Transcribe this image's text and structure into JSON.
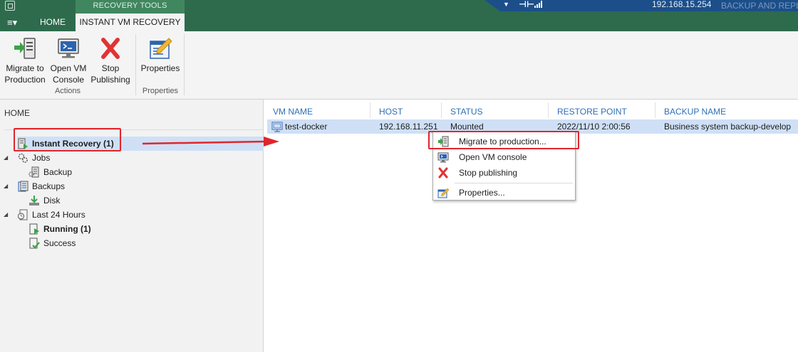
{
  "titlebar": {
    "context_label": "RECOVERY TOOLS",
    "menu_glyph": "≡▾",
    "tabs": [
      {
        "label": "HOME",
        "active": false
      },
      {
        "label": "INSTANT VM RECOVERY",
        "active": true
      }
    ],
    "server": "192.168.15.254",
    "product": "BACKUP AND REPLICATION"
  },
  "ribbon": {
    "groups": [
      {
        "label": "Actions",
        "buttons": [
          {
            "label": "Migrate to Production",
            "icon": "migrate-icon"
          },
          {
            "label": "Open VM Console",
            "icon": "vm-console-icon"
          },
          {
            "label": "Stop Publishing",
            "icon": "stop-red-x-icon"
          }
        ]
      },
      {
        "label": "Properties",
        "buttons": [
          {
            "label": "Properties",
            "icon": "properties-icon"
          }
        ]
      }
    ]
  },
  "tree": {
    "title": "HOME",
    "nodes": [
      {
        "label": "Instant Recovery (1)",
        "icon": "instant-recovery-icon",
        "selected": true,
        "bold": true
      },
      {
        "label": "Jobs",
        "icon": "jobs-gear-icon"
      },
      {
        "label": "Backup",
        "icon": "backup-job-icon"
      },
      {
        "label": "Backups",
        "icon": "backups-icon"
      },
      {
        "label": "Disk",
        "icon": "disk-icon"
      },
      {
        "label": "Last 24 Hours",
        "icon": "last-24-hours-icon"
      },
      {
        "label": "Running (1)",
        "icon": "running-icon",
        "bold": true
      },
      {
        "label": "Success",
        "icon": "success-icon"
      }
    ]
  },
  "list": {
    "columns": [
      "VM NAME",
      "HOST",
      "STATUS",
      "RESTORE POINT",
      "BACKUP NAME"
    ],
    "rows": [
      {
        "vm_name": "test-docker",
        "host": "192.168.11.251",
        "status": "Mounted",
        "restore_point": "2022/11/10 2:00:56",
        "backup_name": "Business system backup-develop"
      }
    ]
  },
  "context_menu": {
    "items": [
      {
        "label": "Migrate to production...",
        "icon": "migrate-icon"
      },
      {
        "label": "Open VM console",
        "icon": "vm-console-icon"
      },
      {
        "label": "Stop publishing",
        "icon": "stop-red-x-icon"
      },
      {
        "label": "Properties...",
        "icon": "properties-icon"
      }
    ]
  },
  "colors": {
    "titlebar_green": "#2e6b4d",
    "context_tab_green": "#40875f",
    "selection_blue": "#cfe0f6",
    "column_header_blue": "#2e6fb7",
    "annotation_red": "#e0262b"
  }
}
